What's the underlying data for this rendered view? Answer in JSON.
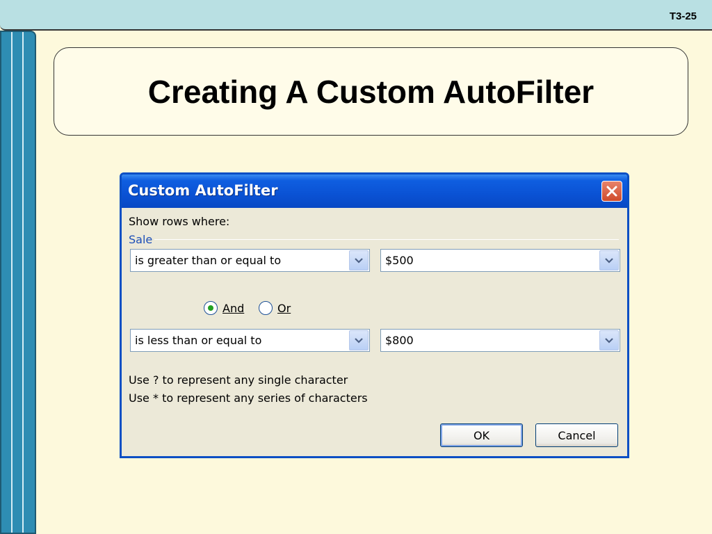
{
  "slide": {
    "number": "T3-25",
    "title": "Creating A Custom AutoFilter"
  },
  "dialog": {
    "title": "Custom AutoFilter",
    "show_rows_label": "Show rows where:",
    "field_name": "Sale",
    "condition1": {
      "operator": "is greater than or equal to",
      "value": "$500"
    },
    "logic": {
      "and_label": "And",
      "or_label": "Or",
      "selected": "And"
    },
    "condition2": {
      "operator": "is less than or equal to",
      "value": "$800"
    },
    "hint1": "Use ? to represent any single character",
    "hint2": "Use * to represent any series of characters",
    "ok_label": "OK",
    "cancel_label": "Cancel"
  },
  "colors": {
    "titlebar": "#0a52d4",
    "dialog_bg": "#ece9d8",
    "slide_bg": "#fdf9dc",
    "sidebar": "#2e8db3",
    "radio_selected": "#21a121"
  },
  "icons": [
    "close-icon",
    "chevron-down-icon"
  ]
}
